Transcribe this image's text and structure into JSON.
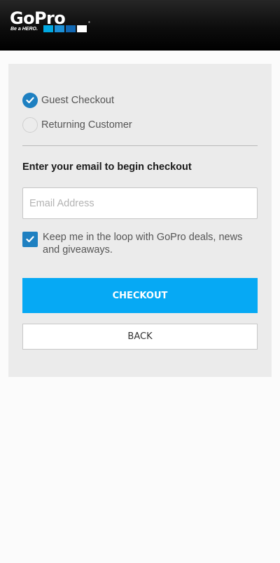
{
  "header": {
    "logo_text": "GoPro",
    "logo_mark": "®",
    "tagline": "Be a HERO.",
    "tagline_colors": [
      "#00a8e1",
      "#1b8fd6",
      "#1268b3",
      "#ffffff"
    ]
  },
  "checkout_type": {
    "options": [
      {
        "label": "Guest Checkout",
        "selected": true,
        "icon": "check-icon"
      },
      {
        "label": "Returning Customer",
        "selected": false
      }
    ]
  },
  "email_section": {
    "heading": "Enter your email to begin checkout",
    "email_placeholder": "Email Address",
    "email_value": ""
  },
  "newsletter": {
    "checked": true,
    "label": "Keep me in the loop with GoPro deals, news and giveaways."
  },
  "buttons": {
    "checkout_label": "CHECKOUT",
    "back_label": "BACK"
  },
  "colors": {
    "accent": "#1e80c1",
    "checkout_button": "#06a9f4",
    "panel_bg": "#ebebeb"
  }
}
